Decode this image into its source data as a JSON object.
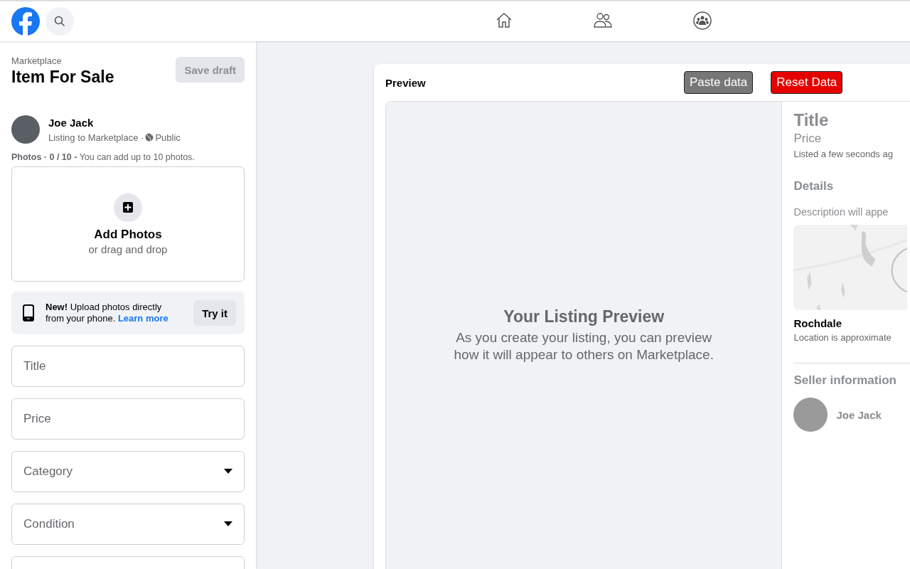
{
  "nav": {
    "tabs": [
      {
        "kind": "home",
        "selected": false
      },
      {
        "kind": "friends",
        "selected": false
      },
      {
        "kind": "groups",
        "selected": false
      }
    ]
  },
  "sidebar": {
    "breadcrumb": "Marketplace",
    "title": "Item For Sale",
    "save_button": {
      "label": "Save draft",
      "disabled": true
    },
    "user": {
      "name": "Joe Jack",
      "audience": "Listing to Marketplace · ",
      "privacy": "Public"
    },
    "photos_hint": "**Photos · 0 / 10 -** You can add up to 10 photos.",
    "add_photos": {
      "title": "Add Photos",
      "subtitle": "or drag and drop"
    },
    "promo": {
      "text": "**New!** Upload photos directly from your phone.",
      "link": "Learn more",
      "button": "Try it"
    },
    "fields": [
      {
        "kind": "text",
        "placeholder": "Title"
      },
      {
        "kind": "text",
        "placeholder": "Price"
      },
      {
        "kind": "select",
        "placeholder": "Category"
      },
      {
        "kind": "select",
        "placeholder": "Condition"
      },
      {
        "kind": "text"
      }
    ]
  },
  "preview": {
    "heading": "Preview",
    "buttons": [
      {
        "label": "Paste data",
        "kind": "neutral"
      },
      {
        "label": "Reset Data",
        "kind": "danger"
      }
    ],
    "placeholder_title": "Your Listing Preview",
    "placeholder_text": "As you create your listing, you can preview how it will appear to others on Marketplace.",
    "details": {
      "title": "Title",
      "price": "Price",
      "listed": "Listed a few seconds ag",
      "details_heading": "Details",
      "description": "Description will appe",
      "location": "Rochdale",
      "location_note": "Location is approximate",
      "seller_heading": "Seller information",
      "seller_name": "Joe Jack"
    }
  }
}
